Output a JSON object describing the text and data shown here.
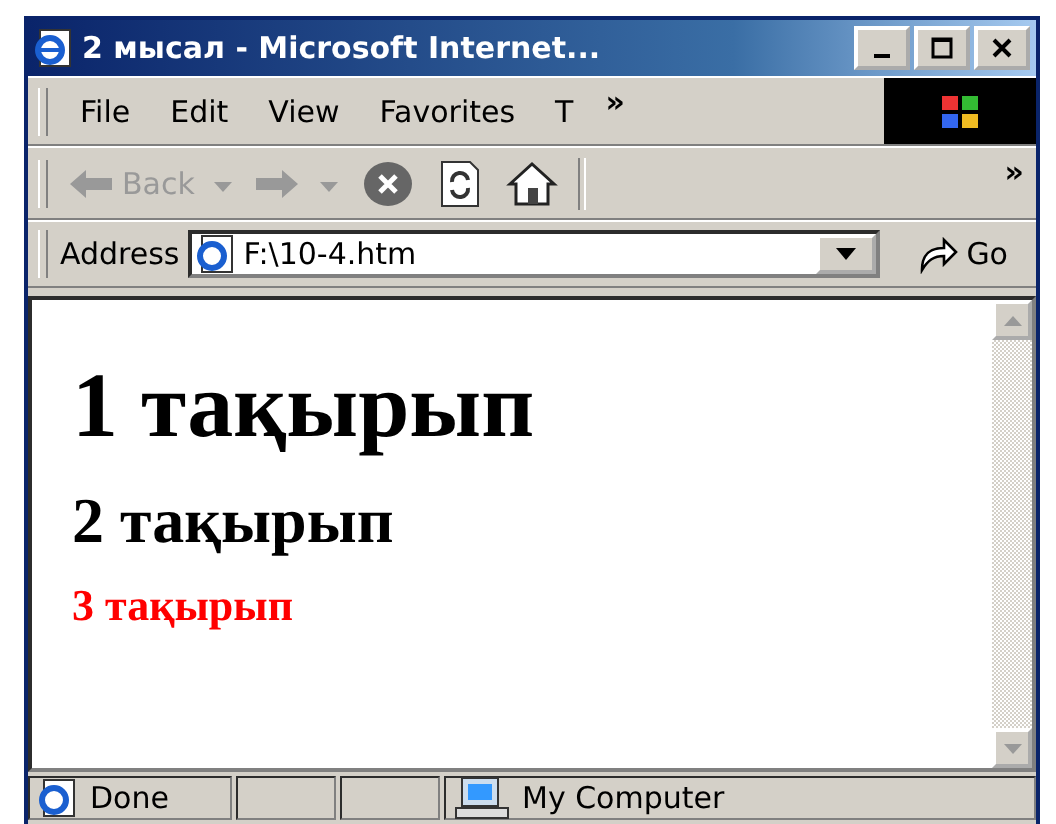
{
  "window": {
    "title": "2 мысал - Microsoft Internet..."
  },
  "menu": {
    "items": [
      "File",
      "Edit",
      "View",
      "Favorites",
      "T"
    ],
    "overflow": "»"
  },
  "toolbar": {
    "buttons": [
      {
        "kind": "back",
        "label": "Back",
        "disabled": true
      },
      {
        "kind": "forward",
        "disabled": true
      },
      {
        "kind": "stop",
        "disabled": false
      },
      {
        "kind": "refresh",
        "disabled": false
      },
      {
        "kind": "home",
        "disabled": false
      }
    ],
    "overflow": "»"
  },
  "address": {
    "label": "Address",
    "value": "F:\\10-4.htm",
    "go": "Go"
  },
  "content": {
    "headings": [
      {
        "kind": "h1",
        "text": "1 тақырып",
        "color": "#000000"
      },
      {
        "kind": "h2",
        "text": "2 тақырып",
        "color": "#000000"
      },
      {
        "kind": "h3",
        "text": "3 тақырып",
        "color": "#ff0000"
      }
    ]
  },
  "status_bar": {
    "text": "Done",
    "zone": "My Computer"
  }
}
